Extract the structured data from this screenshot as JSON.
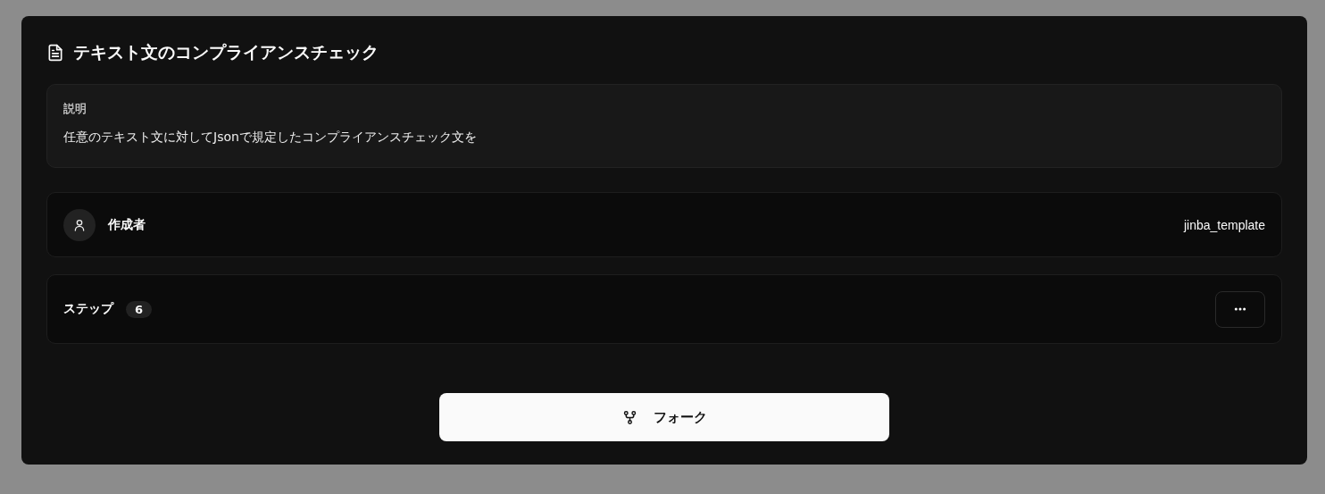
{
  "title": "テキスト文のコンプライアンスチェック",
  "description": {
    "label": "説明",
    "text": "任意のテキスト文に対してJsonで規定したコンプライアンスチェック文を"
  },
  "author": {
    "label": "作成者",
    "value": "jinba_template"
  },
  "steps": {
    "label": "ステップ",
    "count": "6"
  },
  "fork_button": {
    "label": "フォーク"
  }
}
